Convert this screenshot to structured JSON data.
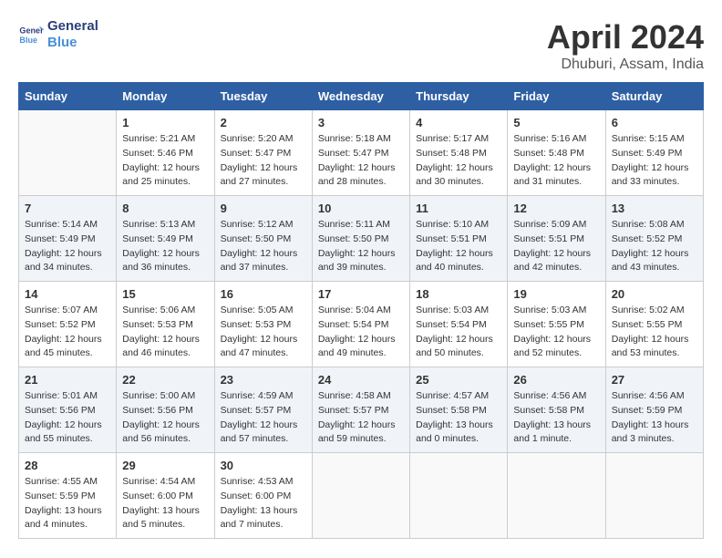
{
  "logo": {
    "line1": "General",
    "line2": "Blue"
  },
  "title": "April 2024",
  "subtitle": "Dhuburi, Assam, India",
  "weekdays": [
    "Sunday",
    "Monday",
    "Tuesday",
    "Wednesday",
    "Thursday",
    "Friday",
    "Saturday"
  ],
  "weeks": [
    [
      {
        "day": "",
        "info": ""
      },
      {
        "day": "1",
        "info": "Sunrise: 5:21 AM\nSunset: 5:46 PM\nDaylight: 12 hours\nand 25 minutes."
      },
      {
        "day": "2",
        "info": "Sunrise: 5:20 AM\nSunset: 5:47 PM\nDaylight: 12 hours\nand 27 minutes."
      },
      {
        "day": "3",
        "info": "Sunrise: 5:18 AM\nSunset: 5:47 PM\nDaylight: 12 hours\nand 28 minutes."
      },
      {
        "day": "4",
        "info": "Sunrise: 5:17 AM\nSunset: 5:48 PM\nDaylight: 12 hours\nand 30 minutes."
      },
      {
        "day": "5",
        "info": "Sunrise: 5:16 AM\nSunset: 5:48 PM\nDaylight: 12 hours\nand 31 minutes."
      },
      {
        "day": "6",
        "info": "Sunrise: 5:15 AM\nSunset: 5:49 PM\nDaylight: 12 hours\nand 33 minutes."
      }
    ],
    [
      {
        "day": "7",
        "info": "Sunrise: 5:14 AM\nSunset: 5:49 PM\nDaylight: 12 hours\nand 34 minutes."
      },
      {
        "day": "8",
        "info": "Sunrise: 5:13 AM\nSunset: 5:49 PM\nDaylight: 12 hours\nand 36 minutes."
      },
      {
        "day": "9",
        "info": "Sunrise: 5:12 AM\nSunset: 5:50 PM\nDaylight: 12 hours\nand 37 minutes."
      },
      {
        "day": "10",
        "info": "Sunrise: 5:11 AM\nSunset: 5:50 PM\nDaylight: 12 hours\nand 39 minutes."
      },
      {
        "day": "11",
        "info": "Sunrise: 5:10 AM\nSunset: 5:51 PM\nDaylight: 12 hours\nand 40 minutes."
      },
      {
        "day": "12",
        "info": "Sunrise: 5:09 AM\nSunset: 5:51 PM\nDaylight: 12 hours\nand 42 minutes."
      },
      {
        "day": "13",
        "info": "Sunrise: 5:08 AM\nSunset: 5:52 PM\nDaylight: 12 hours\nand 43 minutes."
      }
    ],
    [
      {
        "day": "14",
        "info": "Sunrise: 5:07 AM\nSunset: 5:52 PM\nDaylight: 12 hours\nand 45 minutes."
      },
      {
        "day": "15",
        "info": "Sunrise: 5:06 AM\nSunset: 5:53 PM\nDaylight: 12 hours\nand 46 minutes."
      },
      {
        "day": "16",
        "info": "Sunrise: 5:05 AM\nSunset: 5:53 PM\nDaylight: 12 hours\nand 47 minutes."
      },
      {
        "day": "17",
        "info": "Sunrise: 5:04 AM\nSunset: 5:54 PM\nDaylight: 12 hours\nand 49 minutes."
      },
      {
        "day": "18",
        "info": "Sunrise: 5:03 AM\nSunset: 5:54 PM\nDaylight: 12 hours\nand 50 minutes."
      },
      {
        "day": "19",
        "info": "Sunrise: 5:03 AM\nSunset: 5:55 PM\nDaylight: 12 hours\nand 52 minutes."
      },
      {
        "day": "20",
        "info": "Sunrise: 5:02 AM\nSunset: 5:55 PM\nDaylight: 12 hours\nand 53 minutes."
      }
    ],
    [
      {
        "day": "21",
        "info": "Sunrise: 5:01 AM\nSunset: 5:56 PM\nDaylight: 12 hours\nand 55 minutes."
      },
      {
        "day": "22",
        "info": "Sunrise: 5:00 AM\nSunset: 5:56 PM\nDaylight: 12 hours\nand 56 minutes."
      },
      {
        "day": "23",
        "info": "Sunrise: 4:59 AM\nSunset: 5:57 PM\nDaylight: 12 hours\nand 57 minutes."
      },
      {
        "day": "24",
        "info": "Sunrise: 4:58 AM\nSunset: 5:57 PM\nDaylight: 12 hours\nand 59 minutes."
      },
      {
        "day": "25",
        "info": "Sunrise: 4:57 AM\nSunset: 5:58 PM\nDaylight: 13 hours\nand 0 minutes."
      },
      {
        "day": "26",
        "info": "Sunrise: 4:56 AM\nSunset: 5:58 PM\nDaylight: 13 hours\nand 1 minute."
      },
      {
        "day": "27",
        "info": "Sunrise: 4:56 AM\nSunset: 5:59 PM\nDaylight: 13 hours\nand 3 minutes."
      }
    ],
    [
      {
        "day": "28",
        "info": "Sunrise: 4:55 AM\nSunset: 5:59 PM\nDaylight: 13 hours\nand 4 minutes."
      },
      {
        "day": "29",
        "info": "Sunrise: 4:54 AM\nSunset: 6:00 PM\nDaylight: 13 hours\nand 5 minutes."
      },
      {
        "day": "30",
        "info": "Sunrise: 4:53 AM\nSunset: 6:00 PM\nDaylight: 13 hours\nand 7 minutes."
      },
      {
        "day": "",
        "info": ""
      },
      {
        "day": "",
        "info": ""
      },
      {
        "day": "",
        "info": ""
      },
      {
        "day": "",
        "info": ""
      }
    ]
  ]
}
